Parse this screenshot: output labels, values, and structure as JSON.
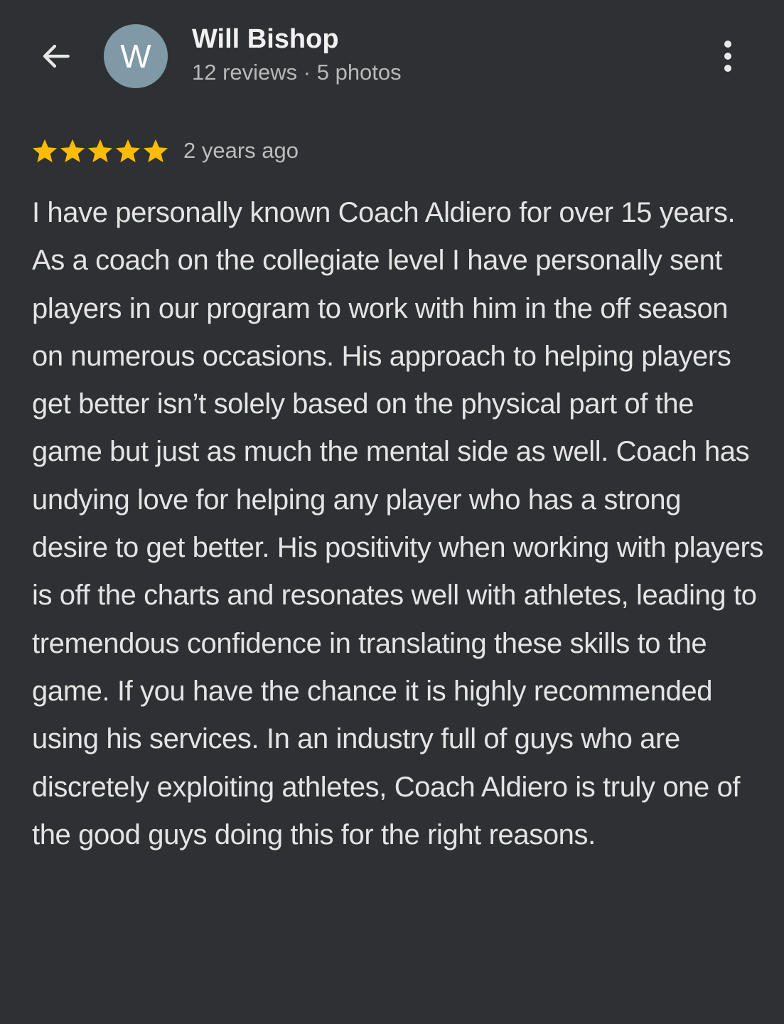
{
  "header": {
    "back_icon": "arrow-left-icon",
    "avatar_letter": "W",
    "avatar_color": "#7f9aa6",
    "reviewer_name": "Will Bishop",
    "reviewer_meta": "12 reviews · 5 photos",
    "more_icon": "more-vertical-icon"
  },
  "review": {
    "rating": 5,
    "rating_max": 5,
    "star_color": "#fbbc04",
    "time_ago": "2 years ago",
    "text": "I have personally known Coach Aldiero for over 15 years. As a coach on the collegiate level I have personally sent players in our program to work with him in the off season on numerous occasions. His approach to helping players get better isn’t solely based on the physical part of the game but just as much the mental side as well. Coach has undying love for helping any player who has a strong desire to get better. His positivity when working with players is off the charts and resonates well with athletes, leading to tremendous confidence in translating these skills to the game. If you have the chance it is highly recommended using his services. In an industry full of guys who are discretely exploiting athletes, Coach Aldiero is truly one of the good guys doing this for the right reasons."
  },
  "theme": {
    "background": "#2f3033"
  }
}
